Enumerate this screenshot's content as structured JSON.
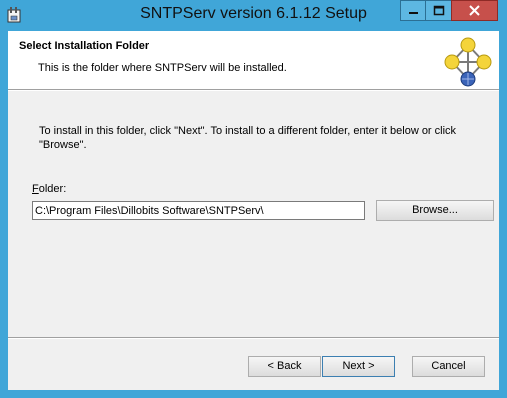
{
  "window": {
    "title": "SNTPServ version 6.1.12 Setup",
    "minimize_glyph": "—",
    "maximize_glyph": "☐",
    "close_glyph": "✕"
  },
  "header": {
    "title": "Select Installation Folder",
    "subtitle": "This is the folder where SNTPServ will be installed."
  },
  "body": {
    "instructions": "To install in this folder, click \"Next\". To install to a different folder, enter it below or click \"Browse\".",
    "folder_label_prefix": "F",
    "folder_label_rest": "older:",
    "folder_value": "C:\\Program Files\\Dillobits Software\\SNTPServ\\",
    "browse_label": "Browse..."
  },
  "buttons": {
    "back": "< Back",
    "next": "Next >",
    "cancel": "Cancel"
  },
  "colors": {
    "frame": "#40a6d8",
    "close": "#c7504b"
  }
}
